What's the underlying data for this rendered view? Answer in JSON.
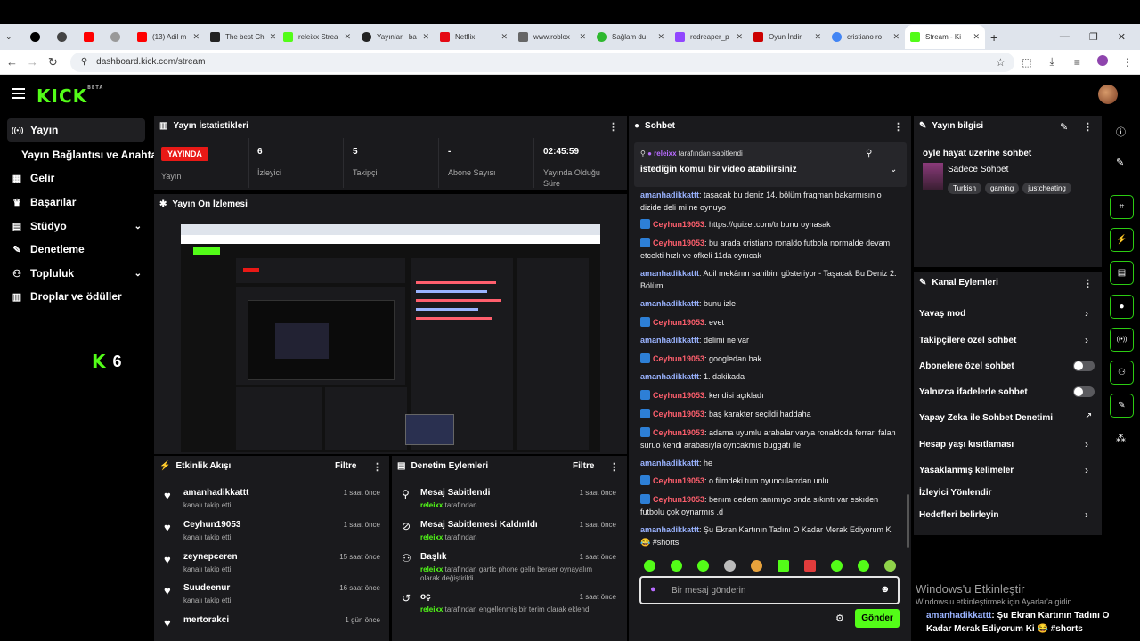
{
  "browser": {
    "tabs": [
      {
        "label": "",
        "color": "#000000"
      },
      {
        "label": "",
        "color": "#444444"
      },
      {
        "label": "",
        "color": "#ff0000"
      },
      {
        "label": "",
        "color": "#999999"
      },
      {
        "label": "(13) Adil m",
        "color": "#ff0000"
      },
      {
        "label": "The best Ch",
        "color": "#222222"
      },
      {
        "label": "releixx Strea",
        "color": "#53fc18"
      },
      {
        "label": "Yayınlar · ba",
        "color": "#222222"
      },
      {
        "label": "Netflix",
        "color": "#e50914"
      },
      {
        "label": "www.roblox",
        "color": "#666666"
      },
      {
        "label": "Sağlam du",
        "color": "#2eb82e"
      },
      {
        "label": "redreaper_p",
        "color": "#9146ff"
      },
      {
        "label": "Oyun İndir",
        "color": "#cc0000"
      },
      {
        "label": "cristiano ro",
        "color": "#4285f4"
      },
      {
        "label": "Stream - Ki",
        "color": "#53fc18"
      }
    ],
    "url": "dashboard.kick.com/stream"
  },
  "header": {
    "logo": "KICK",
    "logo_sup": "BETA"
  },
  "sidebar": {
    "items": [
      {
        "label": "Yayın",
        "icon": "((•))"
      },
      {
        "label": "Yayın Bağlantısı ve Anahtarı",
        "icon": ""
      },
      {
        "label": "Gelir",
        "icon": "▦"
      },
      {
        "label": "Başarılar",
        "icon": "🏆"
      },
      {
        "label": "Stüdyo",
        "icon": "▤"
      },
      {
        "label": "Denetleme",
        "icon": "🔧"
      },
      {
        "label": "Topluluk",
        "icon": "👥"
      },
      {
        "label": "Droplar ve ödüller",
        "icon": "📊"
      }
    ],
    "viewer_count": "6"
  },
  "stats": {
    "title": "Yayın İstatistikleri",
    "live_badge": "YAYINDA",
    "live_label": "Yayın",
    "viewers": "6",
    "viewers_label": "İzleyici",
    "followers": "5",
    "followers_label": "Takipçi",
    "subs": "-",
    "subs_label": "Abone Sayısı",
    "uptime": "02:45:59",
    "uptime_label": "Yayında Olduğu Süre"
  },
  "preview": {
    "title": "Yayın Ön İzlemesi"
  },
  "activity": {
    "title": "Etkinlik Akışı",
    "filter": "Filtre",
    "rows": [
      {
        "name": "amanhadikkattt",
        "sub": "kanalı takip etti",
        "time": "1 saat önce"
      },
      {
        "name": "Ceyhun19053",
        "sub": "kanalı takip etti",
        "time": "1 saat önce"
      },
      {
        "name": "zeynepceren",
        "sub": "kanalı takip etti",
        "time": "15 saat önce"
      },
      {
        "name": "Suudeenur",
        "sub": "kanalı takip etti",
        "time": "16 saat önce"
      },
      {
        "name": "mertorakci",
        "sub": "",
        "time": "1 gün önce"
      }
    ]
  },
  "moderation": {
    "title": "Denetim Eylemleri",
    "filter": "Filtre",
    "rows": [
      {
        "title": "Mesaj Sabitlendi",
        "user": "releixx",
        "detail": "tarafından",
        "time": "1 saat önce"
      },
      {
        "title": "Mesaj Sabitlemesi Kaldırıldı",
        "user": "releixx",
        "detail": "tarafından",
        "time": "1 saat önce"
      },
      {
        "title": "Başlık",
        "user": "releixx",
        "detail": "tarafından gartic phone gelin beraer oynayalım olarak değiştirildi",
        "time": "1 saat önce"
      },
      {
        "title": "oç",
        "user": "releixx",
        "detail": "tarafından engellenmiş bir terim olarak eklendi",
        "time": "1 saat önce"
      }
    ]
  },
  "chat": {
    "title": "Sohbet",
    "pinned_by_user": "releixx",
    "pinned_by_text": "tarafından sabitlendi",
    "pinned_msg": "istediğin komuı bir video atabilirsiniz",
    "messages": [
      {
        "user": "amanhadikkattt",
        "type": "u1",
        "badge": false,
        "text": ": taşacak bu deniz 14. bölüm fragman bakarmısın o dizide deli mi ne oynuyo"
      },
      {
        "user": "Ceyhun19053",
        "type": "u2",
        "badge": true,
        "text": ": https://quizei.com/tr bunu oynasak"
      },
      {
        "user": "Ceyhun19053",
        "type": "u2",
        "badge": true,
        "text": ": bu arada cristiano ronaldo futbola normalde devam etcekti hızlı ve ofkeli 11da oynıcak"
      },
      {
        "user": "amanhadikkattt",
        "type": "u1",
        "badge": false,
        "text": ": Adil mekânın sahibini gösteriyor - Taşacak Bu Deniz 2. Bölüm"
      },
      {
        "user": "amanhadikkattt",
        "type": "u1",
        "badge": false,
        "text": ": bunu izle"
      },
      {
        "user": "Ceyhun19053",
        "type": "u2",
        "badge": true,
        "text": ": evet"
      },
      {
        "user": "amanhadikkattt",
        "type": "u1",
        "badge": false,
        "text": ": delimi ne var"
      },
      {
        "user": "Ceyhun19053",
        "type": "u2",
        "badge": true,
        "text": ": googledan bak"
      },
      {
        "user": "amanhadikkattt",
        "type": "u1",
        "badge": false,
        "text": ": 1. dakikada"
      },
      {
        "user": "Ceyhun19053",
        "type": "u2",
        "badge": true,
        "text": ": kendisi açıkladı"
      },
      {
        "user": "Ceyhun19053",
        "type": "u2",
        "badge": true,
        "text": ": baş karakter seçildi haddaha"
      },
      {
        "user": "Ceyhun19053",
        "type": "u2",
        "badge": true,
        "text": ": adama uyumlu arabalar varya ronaldoda ferrari falan suruo kendi arabasıyla oyncakmıs buggatı ile"
      },
      {
        "user": "amanhadikkattt",
        "type": "u1",
        "badge": false,
        "text": ": he"
      },
      {
        "user": "Ceyhun19053",
        "type": "u2",
        "badge": true,
        "text": ": o filmdeki tum oyuncularrdan unlu"
      },
      {
        "user": "Ceyhun19053",
        "type": "u2",
        "badge": true,
        "text": ": benım dedem tanımıyo onda sıkıntı var eskıden futbolu çok oynarmıs .d"
      },
      {
        "user": "amanhadikkattt",
        "type": "u1",
        "badge": false,
        "text": ": Şu Ekran Kartının Tadını O Kadar Merak Ediyorum Ki 😂 #shorts"
      }
    ],
    "input_placeholder": "Bir mesaj gönderin",
    "send_label": "Gönder"
  },
  "stream_info": {
    "title": "Yayın bilgisi",
    "stream_title": "öyle hayat üzerine sohbet",
    "category": "Sadece Sohbet",
    "tags": [
      "Turkish",
      "gaming",
      "justcheating"
    ]
  },
  "channel_actions": {
    "title": "Kanal Eylemleri",
    "items": [
      {
        "label": "Yavaş mod",
        "control": "chevron"
      },
      {
        "label": "Takipçilere özel sohbet",
        "control": "chevron"
      },
      {
        "label": "Abonelere özel sohbet",
        "control": "toggle"
      },
      {
        "label": "Yalnızca ifadelerle sohbet",
        "control": "toggle"
      },
      {
        "label": "Yapay Zeka ile Sohbet Denetimi",
        "control": "link"
      },
      {
        "label": "Hesap yaşı kısıtlaması",
        "control": "chevron"
      },
      {
        "label": "Yasaklanmış kelimeler",
        "control": "chevron"
      },
      {
        "label": "İzleyici Yönlendir",
        "control": "none"
      },
      {
        "label": "Hedefleri belirleyin",
        "control": "chevron"
      }
    ]
  },
  "windows_activation": {
    "title": "Windows'u Etkinleştir",
    "subtitle": "Windows'u etkinleştirmek için Ayarlar'a gidin."
  },
  "overlay_chat": {
    "user": "amanhadikkattt",
    "text": ": Şu Ekran Kartının Tadını O Kadar Merak Ediyorum Ki 😂 #shorts"
  },
  "colors": {
    "accent": "#53fc18",
    "panel": "#1a1a1d",
    "live": "#e91916"
  }
}
